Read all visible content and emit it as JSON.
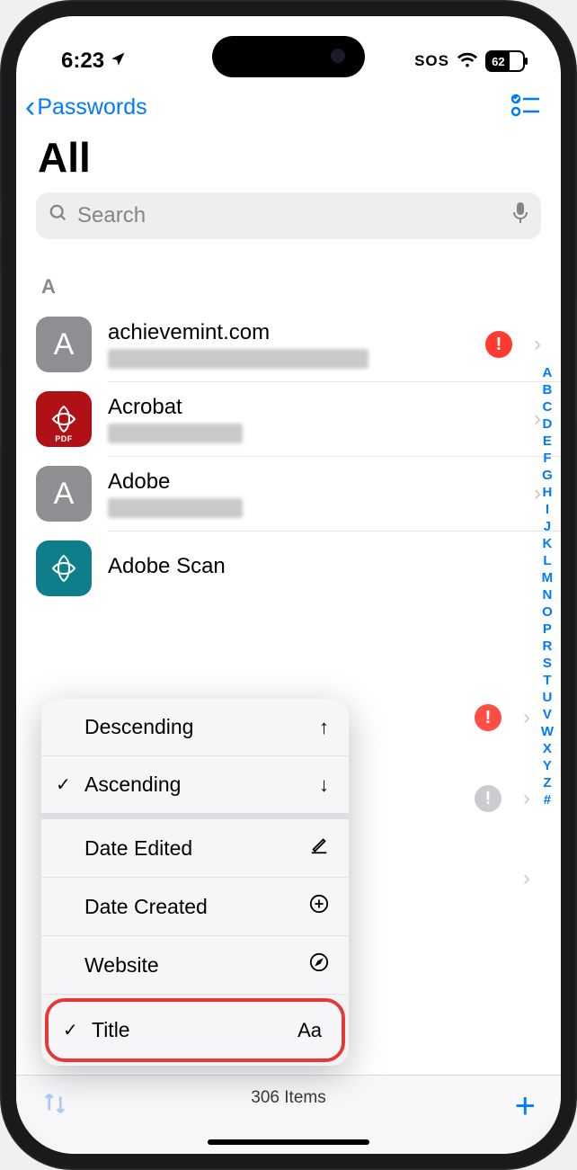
{
  "status": {
    "time": "6:23",
    "sos": "SOS",
    "battery_pct": "62"
  },
  "nav": {
    "back_label": "Passwords"
  },
  "page": {
    "title": "All"
  },
  "search": {
    "placeholder": "Search"
  },
  "section": {
    "header": "A"
  },
  "rows": [
    {
      "title": "achievemint.com",
      "icon_letter": "A",
      "alert": true
    },
    {
      "title": "Acrobat",
      "icon_letter": "PDF"
    },
    {
      "title": "Adobe",
      "icon_letter": "A"
    },
    {
      "title": "Adobe Scan"
    }
  ],
  "index_letters": [
    "A",
    "B",
    "C",
    "D",
    "E",
    "F",
    "G",
    "H",
    "I",
    "J",
    "K",
    "L",
    "M",
    "N",
    "O",
    "P",
    "R",
    "S",
    "T",
    "U",
    "V",
    "W",
    "X",
    "Y",
    "Z",
    "#"
  ],
  "menu": {
    "descending": "Descending",
    "ascending": "Ascending",
    "date_edited": "Date Edited",
    "date_created": "Date Created",
    "website": "Website",
    "title": "Title",
    "title_icon": "Aa"
  },
  "toolbar": {
    "count": "306 Items"
  }
}
